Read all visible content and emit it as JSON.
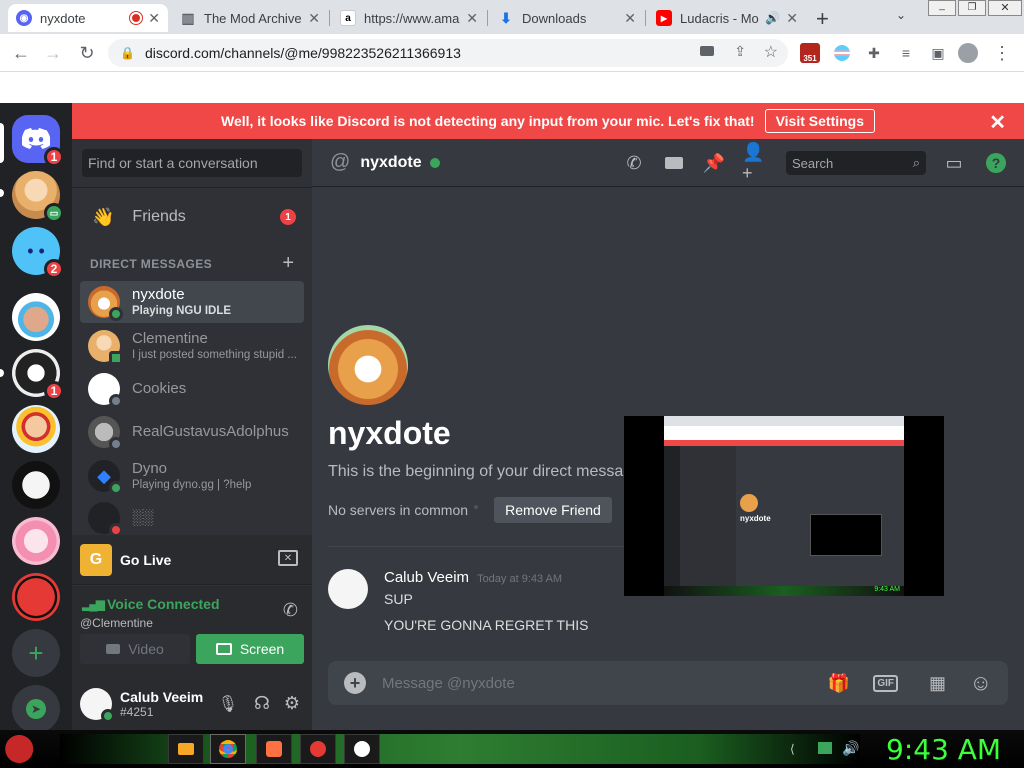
{
  "browser": {
    "tabs": [
      {
        "title": "nyxdote",
        "active": true,
        "favicon": "discord-favicon",
        "recording": true
      },
      {
        "title": "The Mod Archive",
        "favicon": "mod-archive-favicon"
      },
      {
        "title": "https://www.ama",
        "favicon": "amazon-favicon"
      },
      {
        "title": "Downloads",
        "favicon": "download-favicon"
      },
      {
        "title": "Ludacris - Mo",
        "favicon": "youtube-favicon",
        "audio": true
      }
    ],
    "new_tab": "+",
    "url": "discord.com/channels/@me/998223526211366913",
    "ext_badge": "351"
  },
  "discord": {
    "banner": {
      "text": "Well, it looks like Discord is not detecting any input from your mic. Let's fix that!",
      "button": "Visit Settings"
    },
    "guild_badges": {
      "home": "1",
      "g2": "2",
      "g4": "1"
    },
    "search_dm_placeholder": "Find or start a conversation",
    "friends_label": "Friends",
    "friends_badge": "1",
    "dm_header": "DIRECT MESSAGES",
    "dms": [
      {
        "name": "nyxdote",
        "sub": "Playing NGU IDLE",
        "selected": true,
        "status": "#3ba55d"
      },
      {
        "name": "Clementine",
        "sub": "I just posted something stupid ...",
        "status": "#3ba55d"
      },
      {
        "name": "Cookies",
        "sub": "",
        "status": "#747f8d"
      },
      {
        "name": "RealGustavusAdolphus",
        "sub": "",
        "status": "#747f8d"
      },
      {
        "name": "Dyno",
        "sub": "Playing dyno.gg | ?help",
        "status": "#3ba55d"
      }
    ],
    "dm_partial": "░░",
    "go_live": "Go Live",
    "voice": {
      "status": "Voice Connected",
      "channel": "@Clementine",
      "video": "Video",
      "screen": "Screen"
    },
    "user": {
      "name": "Calub Veeim",
      "tag": "#4251"
    },
    "chat": {
      "channel": "nyxdote",
      "search_placeholder": "Search",
      "profile_name": "nyxdote",
      "intro": "This is the beginning of your direct message history with",
      "no_servers": "No servers in common",
      "remove_friend": "Remove Friend",
      "messages": [
        {
          "author": "Calub Veeim",
          "time": "Today at 9:43 AM",
          "lines": [
            "SUP",
            "YOU'RE GONNA REGRET THIS"
          ]
        }
      ],
      "message_placeholder": "Message @nyxdote",
      "gif": "GIF"
    },
    "stream_preview": {
      "name": "nyxdote",
      "time": "9:43 AM"
    }
  },
  "taskbar": {
    "clock": "9:43 AM"
  },
  "colors": {
    "blurple": "#5865f2",
    "red": "#ed4245",
    "green": "#3ba55d",
    "clock": "#3cff3c"
  }
}
